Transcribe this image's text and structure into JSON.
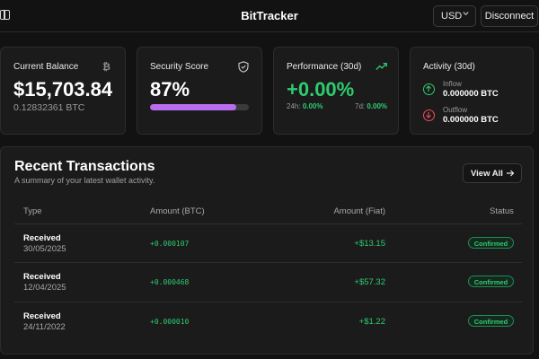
{
  "header": {
    "brand": "BitTracker",
    "currency": "USD",
    "disconnect_label": "Disconnect"
  },
  "balance": {
    "label": "Current Balance",
    "value": "$15,703.84",
    "btc": "0.12832361 BTC"
  },
  "security": {
    "label": "Security Score",
    "value": "87%",
    "progress": 0.87
  },
  "performance": {
    "label": "Performance (30d)",
    "value": "+0.00%",
    "d24_label": "24h:",
    "d24_value": "0.00%",
    "d7_label": "7d:",
    "d7_value": "0.00%"
  },
  "activity": {
    "label": "Activity (30d)",
    "inflow_label": "Inflow",
    "inflow_value": "0.000000 BTC",
    "outflow_label": "Outflow",
    "outflow_value": "0.000000 BTC"
  },
  "transactions": {
    "title": "Recent Transactions",
    "subtitle": "A summary of your latest wallet activity.",
    "view_all_label": "View All",
    "columns": [
      "Type",
      "Amount (BTC)",
      "Amount (Fiat)",
      "Status"
    ],
    "rows": [
      {
        "type": "Received",
        "date": "30/05/2025",
        "btc": "+0.000107",
        "fiat": "+$13.15",
        "status": "Confirmed"
      },
      {
        "type": "Received",
        "date": "12/04/2025",
        "btc": "+0.000468",
        "fiat": "+$57.32",
        "status": "Confirmed"
      },
      {
        "type": "Received",
        "date": "24/11/2022",
        "btc": "+0.000010",
        "fiat": "+$1.22",
        "status": "Confirmed"
      }
    ]
  },
  "colors": {
    "accent_green": "#2ecc71",
    "accent_purple": "#b86cf0",
    "outflow_red": "#ef4b5a"
  }
}
